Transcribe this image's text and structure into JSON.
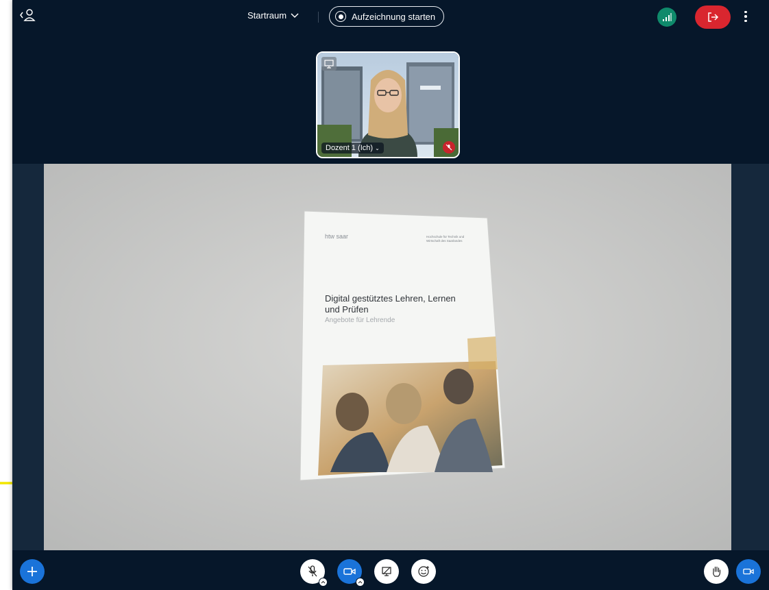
{
  "topbar": {
    "room_name": "Startraum",
    "record_label": "Aufzeichnung starten"
  },
  "presenter": {
    "name_label": "Dozent 1 (Ich)"
  },
  "document": {
    "logo": "htw saar",
    "institution": "Hochschule für Technik und Wirtschaft des Saarlandes",
    "title_line1": "Digital gestütztes Lehren, Lernen",
    "title_line2": "und Prüfen",
    "subtitle": "Angebote für Lehrende"
  },
  "colors": {
    "background": "#06172a",
    "leave": "#d9262f",
    "connection": "#0f8a6b",
    "primary": "#1a73d9",
    "annotation_arrow": "#f2e600"
  },
  "icons": [
    "user-list-icon",
    "chevron-down-icon",
    "record-icon",
    "signal-icon",
    "leave-icon",
    "more-vertical-icon",
    "presentation-icon",
    "mic-off-icon",
    "camera-icon",
    "screen-share-off-icon",
    "emoji-icon",
    "raise-hand-icon",
    "plus-icon"
  ]
}
